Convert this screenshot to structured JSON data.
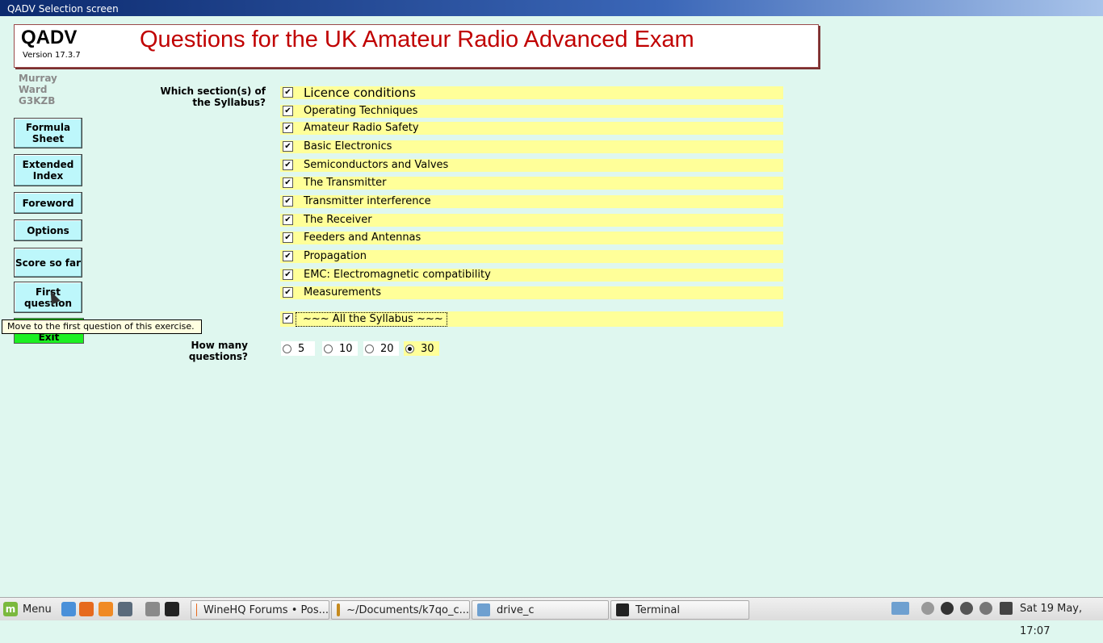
{
  "window": {
    "title": "QADV Selection screen"
  },
  "header": {
    "logo": "QADV",
    "version": "Version 17.3.7",
    "title": "Questions for the UK Amateur Radio Advanced Exam"
  },
  "author": {
    "line1": "Murray",
    "line2": "Ward",
    "line3": "G3KZB"
  },
  "buttons": {
    "formula": "Formula Sheet",
    "extended": "Extended Index",
    "foreword": "Foreword",
    "options": "Options",
    "score": "Score so far",
    "first": "First question",
    "exit": "Exit"
  },
  "tooltip": "Move to the first question of this exercise.",
  "syllabus": {
    "question": "Which section(s) of the Syllabus?",
    "sections": [
      {
        "label": "Licence conditions",
        "checked": true
      },
      {
        "label": "Operating Techniques",
        "checked": true
      },
      {
        "label": "Amateur Radio Safety",
        "checked": true
      },
      {
        "label": "Basic Electronics",
        "checked": true
      },
      {
        "label": "Semiconductors and Valves",
        "checked": true
      },
      {
        "label": "The Transmitter",
        "checked": true
      },
      {
        "label": "Transmitter interference",
        "checked": true
      },
      {
        "label": "The Receiver",
        "checked": true
      },
      {
        "label": "Feeders and Antennas",
        "checked": true
      },
      {
        "label": "Propagation",
        "checked": true
      },
      {
        "label": "EMC: Electromagnetic compatibility",
        "checked": true
      },
      {
        "label": "Measurements",
        "checked": true
      }
    ],
    "all": "~~~   All the Syllabus   ~~~"
  },
  "count": {
    "question": "How many questions?",
    "options": [
      "5",
      "10",
      "20",
      "30"
    ],
    "selected": "30"
  },
  "taskbar": {
    "menu": "Menu",
    "tasks": [
      "WineHQ Forums • Pos...",
      "~/Documents/k7qo_c...",
      "drive_c",
      "Terminal"
    ],
    "clock": "Sat 19 May, 17:07"
  },
  "colors": {
    "background": "#dff7ef",
    "section_bg": "#ffff99",
    "button": "#bdf7fb",
    "exit": "#1cf022",
    "title_red": "#c00000"
  }
}
